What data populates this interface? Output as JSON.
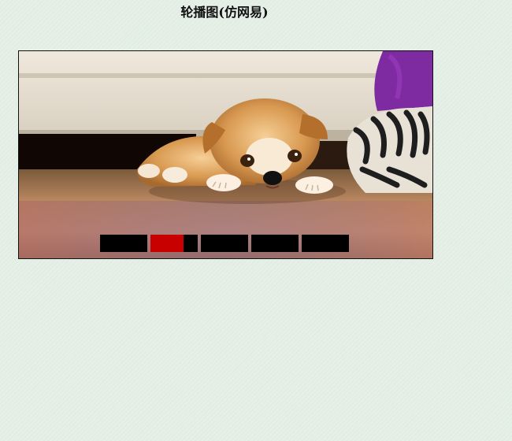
{
  "page": {
    "title": "轮播图(仿网易)"
  },
  "slider": {
    "image_alt": "puppy",
    "active_index": 1,
    "indicators": [
      {
        "progress": 0
      },
      {
        "progress": 0.7
      },
      {
        "progress": 0
      },
      {
        "progress": 0
      },
      {
        "progress": 0
      }
    ],
    "colors": {
      "indicator_bg": "#000000",
      "indicator_progress": "#c80000"
    }
  }
}
